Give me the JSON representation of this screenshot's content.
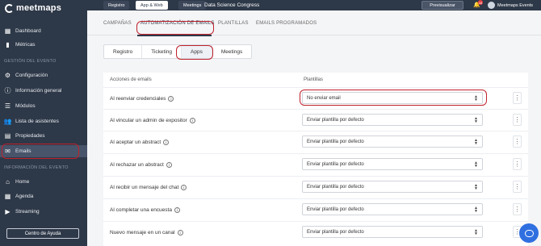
{
  "brand": {
    "name": "meetmaps"
  },
  "topbar": {
    "tabs": [
      {
        "label": "Registro"
      },
      {
        "label": "App & Web"
      },
      {
        "label": "Meetings"
      }
    ],
    "event_name": "Data Science Congress",
    "preview_label": "Previsualizar",
    "notification_count": "16",
    "user_name": "Meetmaps Events"
  },
  "sidebar": {
    "items_top": [
      {
        "label": "Dashboard",
        "icon": "dashboard-icon"
      },
      {
        "label": "Métricas",
        "icon": "metrics-icon"
      }
    ],
    "section_event_management": "GESTIÓN DEL EVENTO",
    "items_management": [
      {
        "label": "Configuración",
        "icon": "gear-icon"
      },
      {
        "label": "Información general",
        "icon": "info-icon"
      },
      {
        "label": "Módulos",
        "icon": "modules-icon"
      },
      {
        "label": "Lista de asistentes",
        "icon": "users-icon"
      },
      {
        "label": "Propiedades",
        "icon": "properties-icon"
      },
      {
        "label": "Emails",
        "icon": "mail-icon"
      }
    ],
    "section_event_info": "INFORMACIÓN DEL EVENTO",
    "items_info": [
      {
        "label": "Home",
        "icon": "home-icon"
      },
      {
        "label": "Agenda",
        "icon": "calendar-icon"
      },
      {
        "label": "Streaming",
        "icon": "streaming-icon"
      }
    ],
    "help_label": "Centro de Ayuda"
  },
  "main": {
    "tabs": [
      {
        "label": "CAMPAÑAS"
      },
      {
        "label": "AUTOMATIZACIÓN DE EMAILS"
      },
      {
        "label": "PLANTILLAS"
      },
      {
        "label": "EMAILS PROGRAMADOS"
      }
    ],
    "subtabs": [
      {
        "label": "Registro"
      },
      {
        "label": "Ticketing"
      },
      {
        "label": "Apps"
      },
      {
        "label": "Meetings"
      }
    ],
    "columns": {
      "actions": "Acciones de emails",
      "templates": "Plantillas"
    },
    "rows": [
      {
        "label": "Al reenviar credenciales",
        "value": "No enviar email"
      },
      {
        "label": "Al vincular un admin de expositor",
        "value": "Enviar plantilla por defecto"
      },
      {
        "label": "Al aceptar un abstract",
        "value": "Enviar plantilla por defecto"
      },
      {
        "label": "Al rechazar un abstract",
        "value": "Enviar plantilla por defecto"
      },
      {
        "label": "Al recibir un mensaje del chat",
        "value": "Enviar plantilla por defecto"
      },
      {
        "label": "Al completar una encuesta",
        "value": "Enviar plantilla por defecto"
      },
      {
        "label": "Nuevo mensaje en un canal",
        "value": "Enviar plantilla por defecto"
      }
    ]
  },
  "colors": {
    "sidebar": "#2d3848",
    "highlight": "#c0222c",
    "chat": "#2f6fe0"
  }
}
